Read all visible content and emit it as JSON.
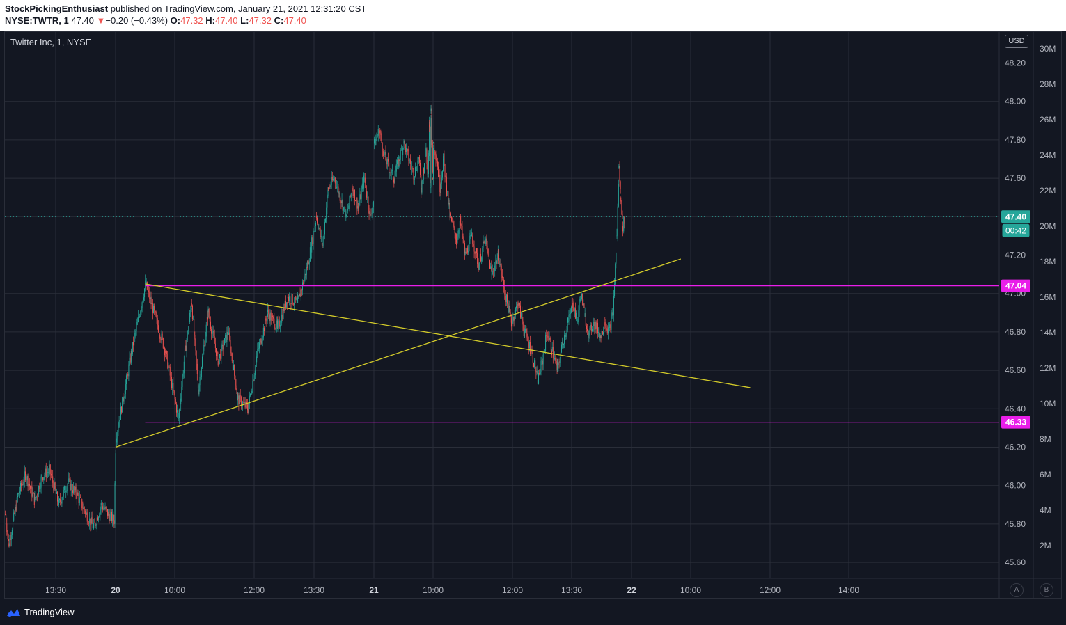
{
  "header": {
    "author": "StockPickingEnthusiast",
    "published_text": "published on TradingView.com, January 21, 2021 12:31:20 CST",
    "symbol": "NYSE:TWTR, 1",
    "last": "47.40",
    "change_arrow": "▼",
    "change": "−0.20 (−0.43%)",
    "open_label": "O:",
    "open": "47.32",
    "high_label": "H:",
    "high": "47.40",
    "low_label": "L:",
    "low": "47.32",
    "close_label": "C:",
    "close": "47.40"
  },
  "legend": {
    "title": "Twitter Inc, 1, NYSE"
  },
  "price_scale": {
    "currency": "USD",
    "ticks": [
      "48.20",
      "48.00",
      "47.80",
      "47.60",
      "47.40",
      "47.20",
      "47.00",
      "46.80",
      "46.60",
      "46.40",
      "46.20",
      "46.00",
      "45.80",
      "45.60"
    ],
    "volume_ticks": [
      "30M",
      "28M",
      "26M",
      "24M",
      "22M",
      "20M",
      "18M",
      "16M",
      "14M",
      "12M",
      "10M",
      "8M",
      "6M",
      "4M",
      "2M"
    ],
    "last_price_label": "47.40",
    "countdown_label": "00:42",
    "level_labels": [
      "47.04",
      "46.33"
    ]
  },
  "time_scale": {
    "ticks": [
      "13:30",
      "20",
      "10:00",
      "12:00",
      "13:30",
      "21",
      "10:00",
      "12:00",
      "13:30",
      "22",
      "10:00",
      "12:00",
      "14:00"
    ]
  },
  "scale_buttons": {
    "auto": "A",
    "log": "B"
  },
  "footer": {
    "brand": "TradingView"
  },
  "colors": {
    "background": "#131722",
    "grid": "#2a2e39",
    "up": "#26a69a",
    "down": "#ef5350",
    "trendline": "#d4cc2a",
    "level": "#e91ee9",
    "last_price": "#26a69a",
    "text": "#b2b5be"
  },
  "chart_data": {
    "type": "candlestick",
    "symbol": "NYSE:TWTR",
    "interval": "1",
    "ylim": [
      45.45,
      48.3
    ],
    "price_anchors": [
      [
        "19 09:30",
        45.85
      ],
      [
        "19 09:40",
        45.7
      ],
      [
        "19 10:05",
        45.95
      ],
      [
        "19 10:25",
        46.06
      ],
      [
        "19 10:50",
        45.92
      ],
      [
        "19 11:10",
        46.05
      ],
      [
        "19 11:30",
        46.08
      ],
      [
        "19 11:55",
        45.9
      ],
      [
        "19 12:20",
        46.02
      ],
      [
        "19 12:45",
        45.95
      ],
      [
        "19 13:10",
        45.85
      ],
      [
        "19 13:30",
        45.78
      ],
      [
        "19 13:50",
        45.9
      ],
      [
        "19 14:10",
        45.85
      ],
      [
        "19 14:25",
        45.82
      ],
      [
        "20 09:30",
        46.25
      ],
      [
        "20 09:38",
        46.7
      ],
      [
        "20 09:45",
        47.05
      ],
      [
        "20 09:55",
        46.7
      ],
      [
        "20 10:05",
        46.35
      ],
      [
        "20 10:15",
        46.7
      ],
      [
        "20 10:25",
        46.95
      ],
      [
        "20 10:35",
        46.5
      ],
      [
        "20 10:50",
        46.9
      ],
      [
        "20 11:05",
        46.65
      ],
      [
        "20 11:20",
        46.8
      ],
      [
        "20 11:35",
        46.45
      ],
      [
        "20 11:50",
        46.4
      ],
      [
        "20 12:05",
        46.7
      ],
      [
        "20 12:20",
        46.9
      ],
      [
        "20 12:35",
        46.82
      ],
      [
        "20 12:50",
        46.98
      ],
      [
        "20 13:05",
        46.95
      ],
      [
        "20 13:20",
        47.15
      ],
      [
        "20 13:35",
        47.4
      ],
      [
        "20 13:50",
        47.25
      ],
      [
        "20 14:05",
        47.55
      ],
      [
        "20 14:20",
        47.6
      ],
      [
        "20 14:35",
        47.5
      ],
      [
        "20 14:50",
        47.4
      ],
      [
        "20 15:05",
        47.55
      ],
      [
        "20 15:20",
        47.45
      ],
      [
        "20 15:35",
        47.6
      ],
      [
        "20 15:50",
        47.4
      ],
      [
        "20 16:00",
        47.5
      ],
      [
        "21 04:00",
        47.78
      ],
      [
        "21 04:30",
        47.85
      ],
      [
        "21 05:00",
        47.72
      ],
      [
        "21 05:30",
        47.65
      ],
      [
        "21 06:00",
        47.6
      ],
      [
        "21 06:30",
        47.7
      ],
      [
        "21 07:00",
        47.78
      ],
      [
        "21 07:30",
        47.7
      ],
      [
        "21 08:00",
        47.62
      ],
      [
        "21 08:30",
        47.7
      ],
      [
        "21 08:45",
        47.55
      ],
      [
        "21 09:00",
        47.65
      ],
      [
        "21 09:15",
        47.75
      ],
      [
        "21 09:25",
        47.62
      ],
      [
        "21 09:30",
        47.7
      ],
      [
        "21 09:35",
        47.88
      ],
      [
        "21 09:40",
        47.55
      ],
      [
        "21 09:45",
        47.95
      ],
      [
        "21 09:50",
        47.8
      ],
      [
        "21 09:55",
        47.6
      ],
      [
        "21 10:00",
        47.78
      ],
      [
        "21 10:05",
        47.7
      ],
      [
        "21 10:10",
        47.55
      ],
      [
        "21 10:15",
        47.7
      ],
      [
        "21 10:20",
        47.55
      ],
      [
        "21 10:25",
        47.4
      ],
      [
        "21 10:35",
        47.28
      ],
      [
        "21 10:40",
        47.38
      ],
      [
        "21 10:48",
        47.2
      ],
      [
        "21 10:58",
        47.3
      ],
      [
        "21 11:08",
        47.15
      ],
      [
        "21 11:18",
        47.28
      ],
      [
        "21 11:28",
        47.1
      ],
      [
        "21 11:38",
        47.2
      ],
      [
        "21 11:48",
        47.0
      ],
      [
        "21 11:58",
        46.85
      ],
      [
        "21 12:08",
        46.95
      ],
      [
        "21 12:18",
        46.8
      ],
      [
        "21 12:28",
        46.7
      ],
      [
        "21 12:38",
        46.55
      ],
      [
        "21 12:45",
        46.65
      ],
      [
        "21 12:52",
        46.8
      ],
      [
        "21 13:00",
        46.7
      ],
      [
        "21 13:08",
        46.6
      ],
      [
        "21 13:16",
        46.75
      ],
      [
        "21 13:24",
        46.85
      ],
      [
        "21 13:32",
        46.95
      ],
      [
        "21 13:40",
        46.85
      ],
      [
        "21 13:48",
        47.0
      ],
      [
        "21 13:56",
        46.88
      ],
      [
        "21 14:04",
        46.78
      ],
      [
        "21 14:12",
        46.85
      ],
      [
        "21 14:20",
        46.82
      ],
      [
        "21 14:28",
        46.78
      ],
      [
        "21 14:36",
        46.85
      ],
      [
        "21 14:44",
        46.8
      ],
      [
        "21 14:52",
        46.9
      ],
      [
        "21 15:00",
        47.3
      ],
      [
        "21 15:04",
        47.65
      ],
      [
        "21 15:08",
        47.5
      ],
      [
        "21 15:12",
        47.35
      ],
      [
        "21 15:16",
        47.4
      ]
    ],
    "horizontal_levels": [
      {
        "price": 47.04,
        "label": "47.04",
        "from": "20 09:45"
      },
      {
        "price": 46.33,
        "label": "46.33",
        "from": "20 09:45"
      }
    ],
    "trendlines": [
      {
        "from": {
          "t": "20 09:45",
          "p": 47.05
        },
        "to": {
          "t": "22 11:30",
          "p": 46.51
        }
      },
      {
        "from": {
          "t": "20 09:30",
          "p": 46.2
        },
        "to": {
          "t": "22 09:00",
          "p": 47.18
        }
      }
    ],
    "last_price": 47.4
  }
}
